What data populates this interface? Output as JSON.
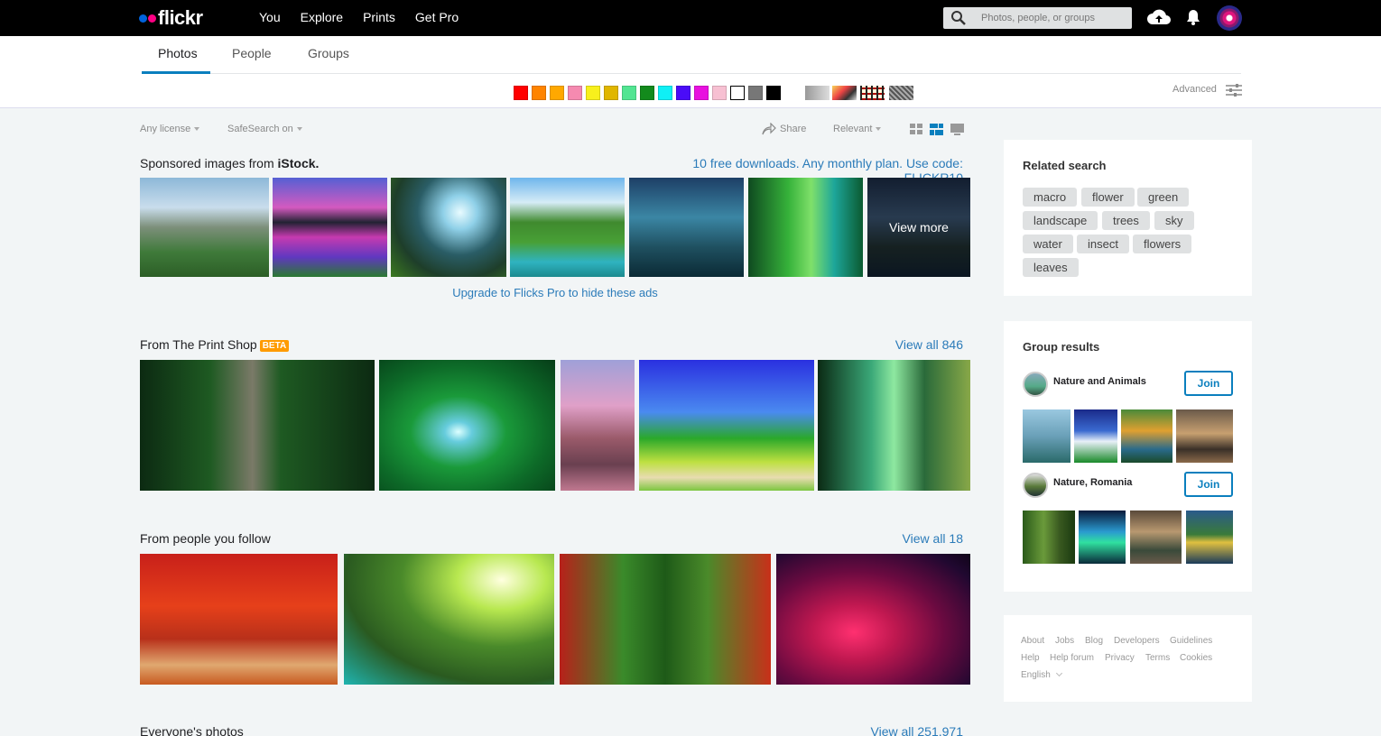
{
  "header": {
    "logo": "flickr",
    "nav": [
      "You",
      "Explore",
      "Prints",
      "Get Pro"
    ],
    "search_placeholder": "Photos, people, or groups"
  },
  "tabs": [
    "Photos",
    "People",
    "Groups"
  ],
  "active_tab": "Photos",
  "color_filters": [
    "#ff0000",
    "#ff8400",
    "#ffa800",
    "#f58ab0",
    "#f8f01c",
    "#e0b600",
    "#52e592",
    "#138a1c",
    "#0ff0f5",
    "#4a0cf7",
    "#e810df",
    "#f7c0d2",
    "#ffffff",
    "#777777",
    "#000000"
  ],
  "advanced_label": "Advanced",
  "filters": {
    "license": "Any license",
    "safesearch": "SafeSearch on",
    "share": "Share",
    "sort": "Relevant"
  },
  "sponsored": {
    "title_prefix": "Sponsored images from ",
    "title_brand": "iStock.",
    "promo": "10 free downloads. Any monthly plan. Use code: FLICKR10",
    "view_more": "View more",
    "upgrade": "Upgrade to Flicks Pro to hide these ads"
  },
  "print_shop": {
    "title": "From The Print Shop",
    "badge": "BETA",
    "link": "View all 846"
  },
  "following": {
    "title": "From people you follow",
    "link": "View all 18"
  },
  "everyone": {
    "title": "Everyone's photos",
    "link": "View all 251,971"
  },
  "related": {
    "title": "Related search",
    "tags": [
      "macro",
      "flower",
      "green",
      "landscape",
      "trees",
      "sky",
      "water",
      "insect",
      "flowers",
      "leaves"
    ]
  },
  "groups": {
    "title": "Group results",
    "items": [
      {
        "name": "Nature and Animals",
        "join": "Join"
      },
      {
        "name": "Nature, Romania",
        "join": "Join"
      }
    ]
  },
  "footer": {
    "links": [
      "About",
      "Jobs",
      "Blog",
      "Developers",
      "Guidelines",
      "Help",
      "Help forum",
      "Privacy",
      "Terms",
      "Cookies"
    ],
    "language": "English"
  }
}
